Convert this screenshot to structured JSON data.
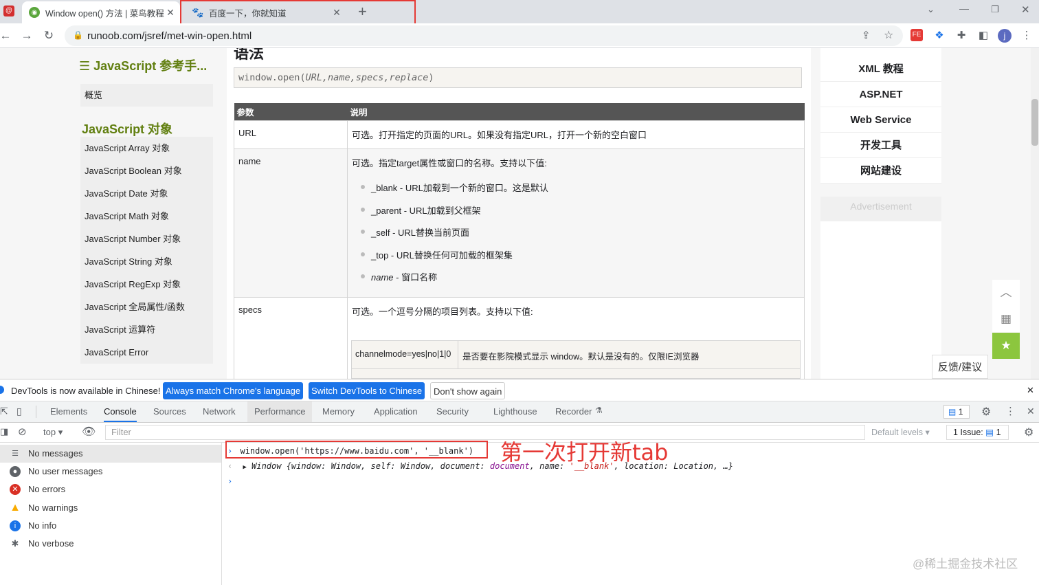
{
  "browser": {
    "tabs": [
      {
        "title": "Window open() 方法 | 菜鸟教程",
        "active": true
      },
      {
        "title": "百度一下，你就知道",
        "active": false
      }
    ],
    "new_tab": "+",
    "url": "runoob.com/jsref/met-win-open.html",
    "profile_initial": "j"
  },
  "left_nav": {
    "header": "JavaScript 参考手...",
    "overview": "概览",
    "section_title": "JavaScript 对象",
    "items": [
      "JavaScript Array 对象",
      "JavaScript Boolean 对象",
      "JavaScript Date 对象",
      "JavaScript Math 对象",
      "JavaScript Number 对象",
      "JavaScript String 对象",
      "JavaScript RegExp 对象",
      "JavaScript 全局属性/函数",
      "JavaScript 运算符",
      "JavaScript Error"
    ]
  },
  "main": {
    "heading": "语法",
    "syntax_fn": "window.open(",
    "syntax_args": "URL,name,specs,replace",
    "syntax_end": ")",
    "table": {
      "headers": [
        "参数",
        "说明"
      ],
      "url_param": "URL",
      "url_desc": "可选。打开指定的页面的URL。如果没有指定URL，打开一个新的空白窗口",
      "name_param": "name",
      "name_desc": "可选。指定target属性或窗口的名称。支持以下值:",
      "name_values": [
        "_blank - URL加载到一个新的窗口。这是默认",
        "_parent - URL加载到父框架",
        "_self - URL替换当前页面",
        "_top - URL替换任何可加载的框架集"
      ],
      "name_last_italic": "name",
      "name_last_rest": " - 窗口名称",
      "specs_param": "specs",
      "specs_desc": "可选。一个逗号分隔的项目列表。支持以下值:",
      "specs_sub_key": "channelmode=yes|no|1|0",
      "specs_sub_desc": "是否要在影院模式显示 window。默认是没有的。仅限IE浏览器"
    }
  },
  "right_nav": {
    "links": [
      "XML 教程",
      "ASP.NET",
      "Web Service",
      "开发工具",
      "网站建设"
    ],
    "ad_label": "Advertisement",
    "feedback": "反馈/建议"
  },
  "devtools": {
    "info_text": "DevTools is now available in Chinese!",
    "btn_match": "Always match Chrome's language",
    "btn_switch": "Switch DevTools to Chinese",
    "btn_dismiss": "Don't show again",
    "tabs": [
      "Elements",
      "Console",
      "Sources",
      "Network",
      "Performance",
      "Memory",
      "Application",
      "Security",
      "Lighthouse",
      "Recorder"
    ],
    "issues_badge": "1",
    "context": "top",
    "filter_placeholder": "Filter",
    "levels": "Default levels",
    "issues_label": "1 Issue:",
    "issues_count": "1",
    "side_items": [
      "No messages",
      "No user messages",
      "No errors",
      "No warnings",
      "No info",
      "No verbose"
    ],
    "console_input": "window.open('https://www.baidu.com', '__blank')",
    "console_output_prefix": "Window {window: Window, self: Window, document: ",
    "console_output_doc": "document",
    "console_output_name_key": ", name: ",
    "console_output_name_val": "'__blank'",
    "console_output_rest": ", location: Location, …}"
  },
  "annotation": "第一次打开新tab",
  "watermark": "@稀土掘金技术社区",
  "colors": {
    "accent": "#1a73e8",
    "annotation": "#e53935",
    "runoob_green": "#617f10"
  }
}
